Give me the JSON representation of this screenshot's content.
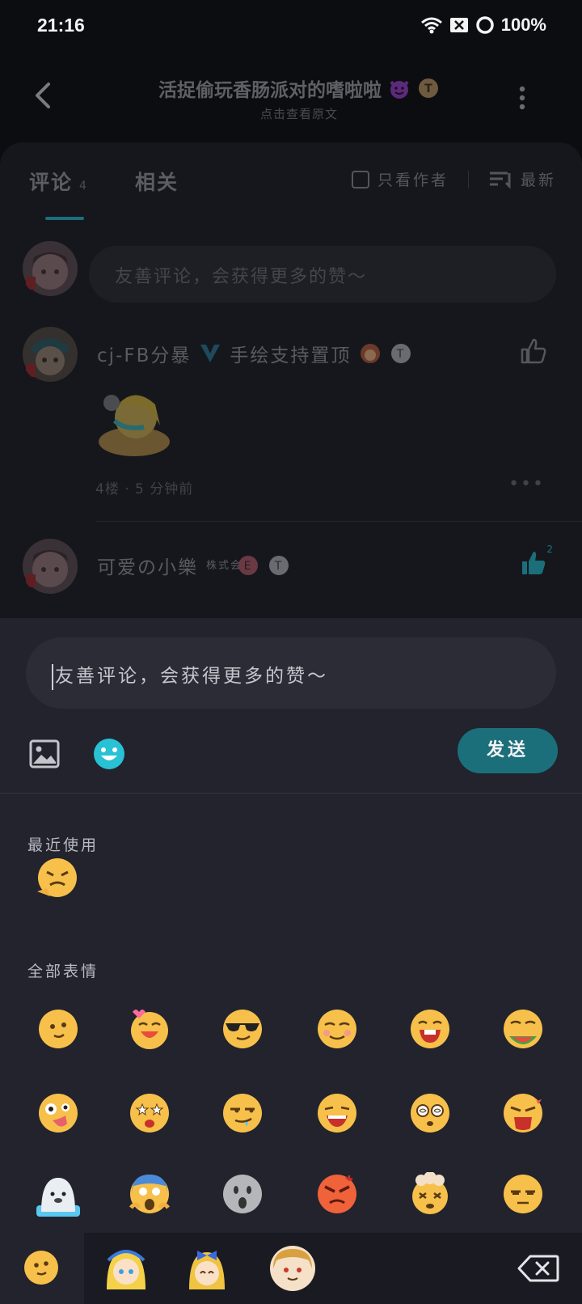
{
  "status_bar": {
    "time": "21:16",
    "battery": "100%"
  },
  "header": {
    "title": "活捉偷玩香肠派对的嗜啦啦",
    "subtitle": "点击查看原文",
    "title_badge": "T"
  },
  "tabs": [
    {
      "label": "评论",
      "count": "4"
    },
    {
      "label": "相关"
    }
  ],
  "filters": {
    "only_author": "只看作者",
    "sort": "最新"
  },
  "comment_placeholder": "友善评论，会获得更多的赞～",
  "comments": [
    {
      "name": "cj-FB分暴",
      "tag": "手绘支持置顶",
      "badge": "T",
      "meta": "4楼 · 5 分钟前"
    },
    {
      "name": "可爱の小樂",
      "name_suffix": "株式会社",
      "badge": "T",
      "likes": "2"
    }
  ],
  "composer": {
    "placeholder": "友善评论，会获得更多的赞～",
    "send_label": "发送"
  },
  "emoji_panel": {
    "recent_label": "最近使用",
    "all_label": "全部表情"
  },
  "colors": {
    "accent": "#1b6f7b",
    "panel_bg": "#22232d",
    "emoji_face": "#f6c04a"
  }
}
